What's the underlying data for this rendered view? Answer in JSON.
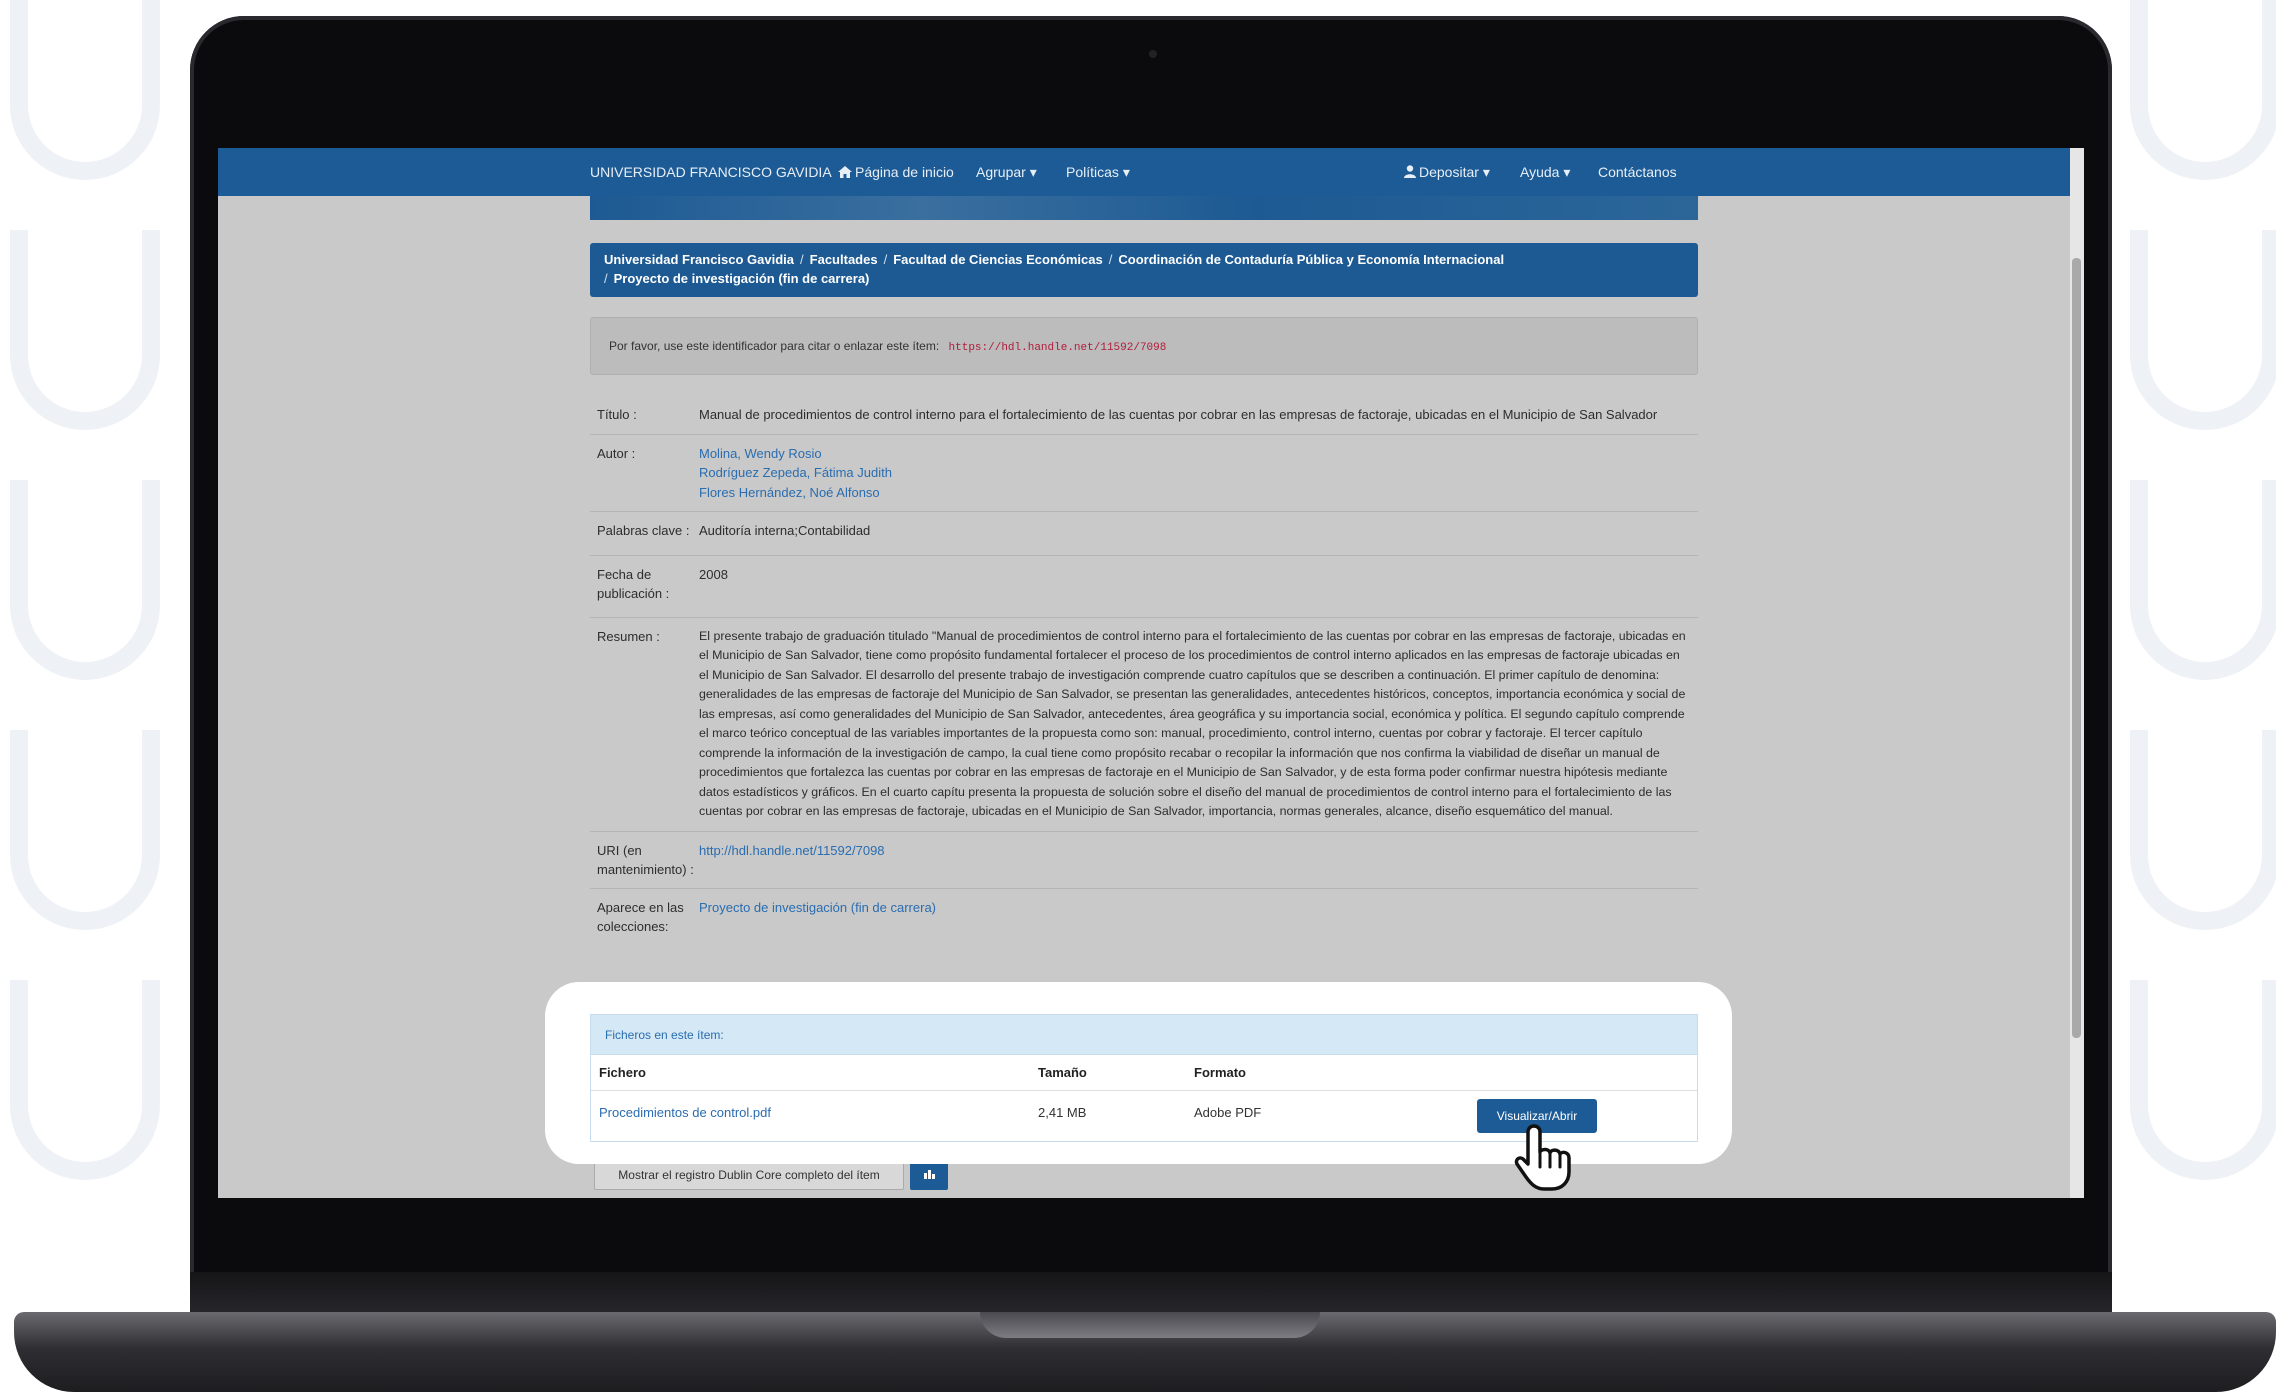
{
  "nav": {
    "brand": "UNIVERSIDAD FRANCISCO GAVIDIA",
    "home": "Página de inicio",
    "group": "Agrupar",
    "policies": "Políticas",
    "deposit": "Depositar",
    "help": "Ayuda",
    "contact": "Contáctanos"
  },
  "breadcrumb": {
    "items": [
      "Universidad Francisco Gavidia",
      "Facultades",
      "Facultad de Ciencias Económicas",
      "Coordinación de Contaduría Pública y Economía Internacional",
      "Proyecto de investigación (fin de carrera)"
    ]
  },
  "cite": {
    "text": "Por favor, use este identificador para citar o enlazar este ítem:",
    "handle": "https://hdl.handle.net/11592/7098"
  },
  "meta": {
    "title_label": "Título :",
    "title_value": "Manual de procedimientos de control interno para el fortalecimiento de las cuentas por cobrar en las empresas de factoraje, ubicadas en el Municipio de San Salvador",
    "author_label": "Autor :",
    "authors": [
      "Molina, Wendy Rosio",
      "Rodríguez Zepeda, Fátima Judith",
      "Flores Hernández, Noé Alfonso"
    ],
    "keywords_label": "Palabras clave :",
    "keywords_value": "Auditoría interna;Contabilidad",
    "date_label": "Fecha de publicación :",
    "date_value": "2008",
    "abstract_label": "Resumen :",
    "abstract_value": "El presente trabajo de graduación titulado \"Manual de procedimientos de control interno para el fortalecimiento de las cuentas por cobrar en las empresas de factoraje, ubicadas en el Municipio de San Salvador, tiene como propósito fundamental fortalecer el proceso de los procedimientos de control interno aplicados en las empresas de factoraje ubicadas en el Municipio de San Salvador. El desarrollo del presente trabajo de investigación comprende cuatro capítulos que se describen a continuación. El primer capítulo de denomina: generalidades de las empresas de factoraje del Municipio de San Salvador, se presentan las generalidades, antecedentes históricos, conceptos, importancia económica y social de las empresas, así como generalidades del Municipio de San Salvador, antecedentes, área geográfica y su importancia social, económica y política. El segundo capítulo comprende el marco teórico conceptual de las variables importantes de la propuesta como son: manual, procedimiento, control interno, cuentas por cobrar y factoraje. El tercer capítulo comprende la información de la investigación de campo, la cual tiene como propósito recabar o recopilar la información que nos confirma la viabilidad de diseñar un manual de procedimientos que fortalezca las cuentas por cobrar en las empresas de factoraje en el Municipio de San Salvador, y de esta forma poder confirmar nuestra hipótesis mediante datos estadísticos y gráficos. En el cuarto capítu presenta la propuesta de solución sobre el diseño del manual de procedimientos de control interno para el fortalecimiento de las cuentas por cobrar en las empresas de factoraje, ubicadas en el Municipio de San Salvador, importancia, normas generales, alcance, diseño esquemático del manual.",
    "uri_label": "URI (en mantenimiento) :",
    "uri_value": "http://hdl.handle.net/11592/7098",
    "collections_label": "Aparece en las colecciones:",
    "collections_value": "Proyecto de investigación (fin de carrera)"
  },
  "files": {
    "heading": "Ficheros en este ítem:",
    "col_file": "Fichero",
    "col_size": "Tamaño",
    "col_format": "Formato",
    "file_name": "Procedimientos de control.pdf",
    "file_size": "2,41 MB",
    "file_format": "Adobe PDF",
    "open_label": "Visualizar/Abrir"
  },
  "dublin_core_label": "Mostrar el registro Dublin Core completo del ítem",
  "colors": {
    "primary": "#1c5b96",
    "link": "#2a6db0",
    "handle": "#b01c3a",
    "files_head_bg": "#d4e8f5"
  },
  "icons": [
    "home-icon",
    "user-icon",
    "bar-chart-icon",
    "hand-cursor-icon"
  ]
}
